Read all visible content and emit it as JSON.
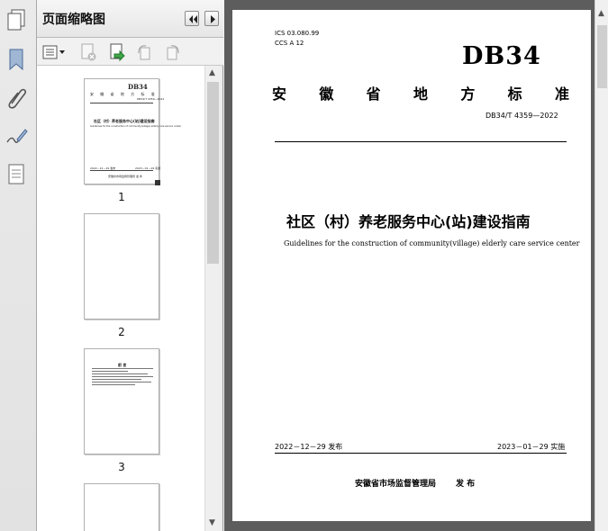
{
  "panel": {
    "title": "页面缩略图"
  },
  "thumbnails": [
    {
      "label": "1"
    },
    {
      "label": "2"
    },
    {
      "label": "3"
    }
  ],
  "thumb1": {
    "code": "DB34",
    "org": "安 徽 省 地 方 标 准",
    "number": "DB34/T 4359—2022",
    "title": "社区（村）养老服务中心(站)建设指南",
    "title_en": "Guidelines for the construction of community(village) elderly care service center",
    "publish": "2022－12－29 发布",
    "implement": "2023－01－29 实施",
    "issuer": "安徽省市场监督管理局  发 布"
  },
  "thumb3": {
    "heading": "前 言"
  },
  "document": {
    "ics": "ICS 03.080.99",
    "ccs": "CCS A 12",
    "logo": "DB34",
    "org": [
      "安",
      "徽",
      "省",
      "地",
      "方",
      "标",
      "准"
    ],
    "number": "DB34/T 4359—2022",
    "title": "社区（村）养老服务中心(站)建设指南",
    "title_en": "Guidelines for the construction of community(village) elderly care service center",
    "publish_date": "2022－12－29 发布",
    "implement_date": "2023－01－29 实施",
    "issuer": "安徽省市场监督管理局",
    "issuer_suffix": "发 布"
  }
}
